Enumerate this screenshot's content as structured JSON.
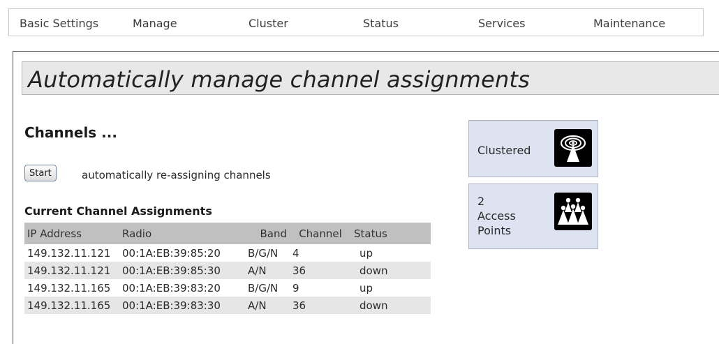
{
  "nav": {
    "items": [
      "Basic Settings",
      "Manage",
      "Cluster",
      "Status",
      "Services",
      "Maintenance"
    ]
  },
  "page": {
    "title": "Automatically manage channel assignments"
  },
  "channels": {
    "heading": "Channels ...",
    "start_button_label": "Start",
    "start_description": "automatically re-assigning channels"
  },
  "assignments": {
    "title": "Current Channel Assignments",
    "columns": [
      "IP Address",
      "Radio",
      "Band",
      "Channel",
      "Status"
    ],
    "rows": [
      [
        "149.132.11.121",
        "00:1A:EB:39:85:20",
        "B/G/N",
        "4",
        "up"
      ],
      [
        "149.132.11.121",
        "00:1A:EB:39:85:30",
        "A/N",
        "36",
        "down"
      ],
      [
        "149.132.11.165",
        "00:1A:EB:39:83:20",
        "B/G/N",
        "9",
        "up"
      ],
      [
        "149.132.11.165",
        "00:1A:EB:39:83:30",
        "A/N",
        "36",
        "down"
      ]
    ]
  },
  "status_boxes": {
    "clustered": {
      "label": "Clustered",
      "icon": "cluster-antenna-icon"
    },
    "access_points": {
      "count": "2",
      "label_line1": "Access",
      "label_line2": "Points",
      "icon": "access-points-group-icon"
    }
  },
  "colors": {
    "title_bar_bg": "#e8e8e8",
    "table_header_bg": "#c0c0c0",
    "table_alt_row_bg": "#e6e6e6",
    "status_box_bg": "#dde3f0",
    "icon_tile_bg": "#000000"
  }
}
